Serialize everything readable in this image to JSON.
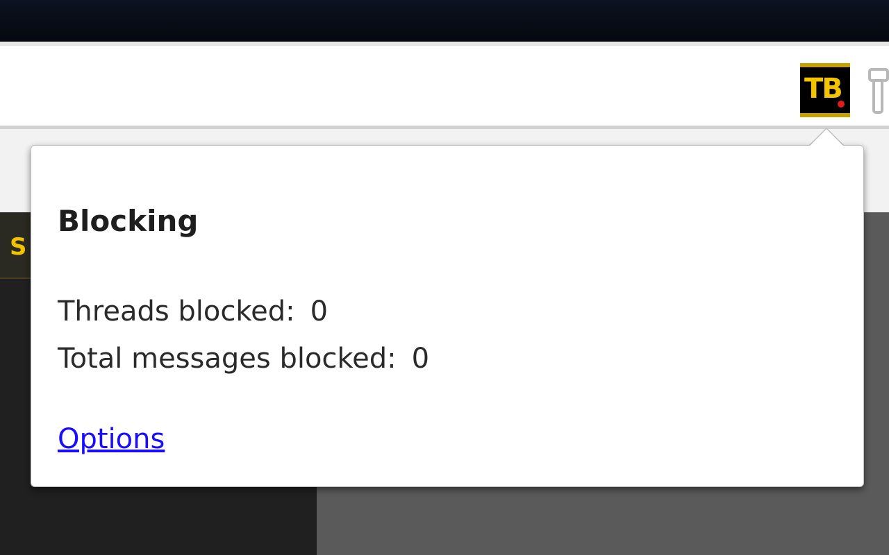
{
  "browser": {
    "extension_button": {
      "label": "TB",
      "icon": "tb-extension-icon",
      "colors": {
        "background": "#000000",
        "text": "#f5c400",
        "badge": "#e21a1a"
      }
    },
    "menu_icon": "wrench-icon"
  },
  "page": {
    "visible_letter": "S"
  },
  "popup": {
    "heading": "Blocking",
    "stats": [
      {
        "label": "Threads blocked:",
        "value": "0"
      },
      {
        "label": "Total messages blocked:",
        "value": "0"
      }
    ],
    "options_link": "Options",
    "colors": {
      "link": "#1a0dff",
      "text": "#2a2a2a"
    }
  }
}
